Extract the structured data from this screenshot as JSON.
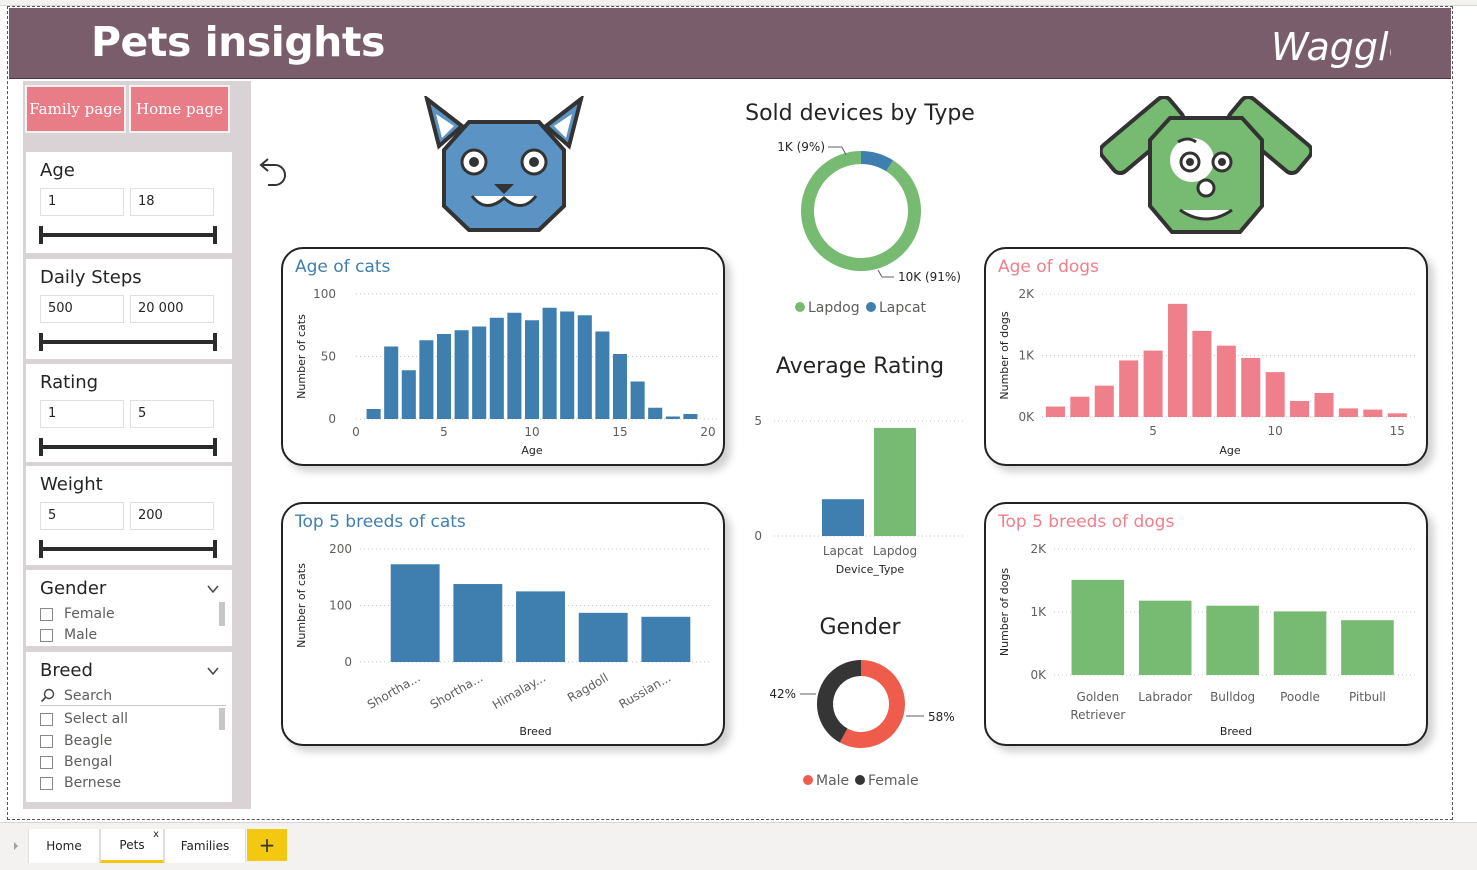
{
  "header": {
    "title": "Pets insights",
    "logo_text": "Waggle"
  },
  "nav": {
    "family_label": "Family page",
    "home_label": "Home page"
  },
  "filters": {
    "age": {
      "title": "Age",
      "min": "1",
      "max": "18"
    },
    "steps": {
      "title": "Daily Steps",
      "min": "500",
      "max": "20 000"
    },
    "rating": {
      "title": "Rating",
      "min": "1",
      "max": "5"
    },
    "weight": {
      "title": "Weight",
      "min": "5",
      "max": "200"
    },
    "gender": {
      "title": "Gender",
      "options": [
        "Female",
        "Male"
      ]
    },
    "breed": {
      "title": "Breed",
      "search_placeholder": "Search",
      "options": [
        "Select all",
        "Beagle",
        "Bengal",
        "Bernese"
      ]
    }
  },
  "icons": {
    "back": "undo-arrow-icon",
    "cat": "cat-face-icon",
    "dog": "dog-face-icon",
    "chevron": "chevron-down-icon",
    "search": "search-icon"
  },
  "colors": {
    "header": "#7a5d6b",
    "cat_blue": "#3f7fb0",
    "dog_pink": "#f07f8c",
    "dog_green": "#77bb72",
    "nav_button": "#e87d88",
    "male": "#ef5c4b",
    "female": "#353535",
    "tab_accent": "#f2c811"
  },
  "tabs": {
    "home": "Home",
    "pets": "Pets",
    "families": "Families",
    "close": "x",
    "add": "+"
  },
  "chart_data": [
    {
      "id": "age_cats",
      "type": "bar",
      "title": "Age of cats",
      "xlabel": "Age",
      "ylabel": "Number of cats",
      "ylim": [
        0,
        100
      ],
      "xlim": [
        0,
        20
      ],
      "yticks": [
        "0",
        "50",
        "100"
      ],
      "xticks": [
        "0",
        "5",
        "10",
        "15",
        "20"
      ],
      "x": [
        1,
        2,
        3,
        4,
        5,
        6,
        7,
        8,
        9,
        10,
        11,
        12,
        13,
        14,
        15,
        16,
        17,
        18
      ],
      "values": [
        8,
        58,
        39,
        63,
        68,
        71,
        74,
        81,
        85,
        79,
        89,
        86,
        83,
        70,
        52,
        30,
        9,
        2,
        4
      ]
    },
    {
      "id": "breeds_cats",
      "type": "bar",
      "title": "Top 5 breeds of cats",
      "xlabel": "Breed",
      "ylabel": "Number of cats",
      "ylim": [
        0,
        200
      ],
      "yticks": [
        "0",
        "100",
        "200"
      ],
      "categories": [
        "Shortha...",
        "Shortha...",
        "Himalay...",
        "Ragdoll",
        "Russian..."
      ],
      "values": [
        173,
        138,
        125,
        87,
        80
      ]
    },
    {
      "id": "age_dogs",
      "type": "bar",
      "title": "Age of dogs",
      "xlabel": "Age",
      "ylabel": "Number of dogs",
      "ylim": [
        0,
        2000
      ],
      "yticks": [
        "0K",
        "1K",
        "2K"
      ],
      "xticks": [
        "5",
        "10",
        "15"
      ],
      "values": [
        170,
        330,
        510,
        920,
        1080,
        1840,
        1400,
        1160,
        960,
        730,
        260,
        390,
        140,
        120,
        60
      ]
    },
    {
      "id": "breeds_dogs",
      "type": "bar",
      "title": "Top 5 breeds of dogs",
      "xlabel": "Breed",
      "ylabel": "Number of dogs",
      "ylim": [
        0,
        2000
      ],
      "yticks": [
        "0K",
        "1K",
        "2K"
      ],
      "categories": [
        "Golden Retriever",
        "Labrador",
        "Bulldog",
        "Poodle",
        "Pitbull"
      ],
      "values": [
        1510,
        1180,
        1100,
        1010,
        870
      ]
    },
    {
      "id": "sold_devices",
      "type": "pie",
      "title": "Sold devices by Type",
      "categories": [
        "Lapcat",
        "Lapdog"
      ],
      "values": [
        9,
        91
      ],
      "labels": [
        "1K (9%)",
        "10K (91%)"
      ],
      "legend": [
        "Lapdog",
        "Lapcat"
      ]
    },
    {
      "id": "avg_rating",
      "type": "bar",
      "title": "Average Rating",
      "xlabel": "Device_Type",
      "ylim": [
        0,
        5
      ],
      "yticks": [
        "0",
        "5"
      ],
      "categories": [
        "Lapcat",
        "Lapdog"
      ],
      "values": [
        1.6,
        4.7
      ]
    },
    {
      "id": "gender",
      "type": "pie",
      "title": "Gender",
      "categories": [
        "Male",
        "Female"
      ],
      "values": [
        58,
        42
      ],
      "labels": [
        "58%",
        "42%"
      ],
      "legend": [
        "Male",
        "Female"
      ]
    }
  ]
}
